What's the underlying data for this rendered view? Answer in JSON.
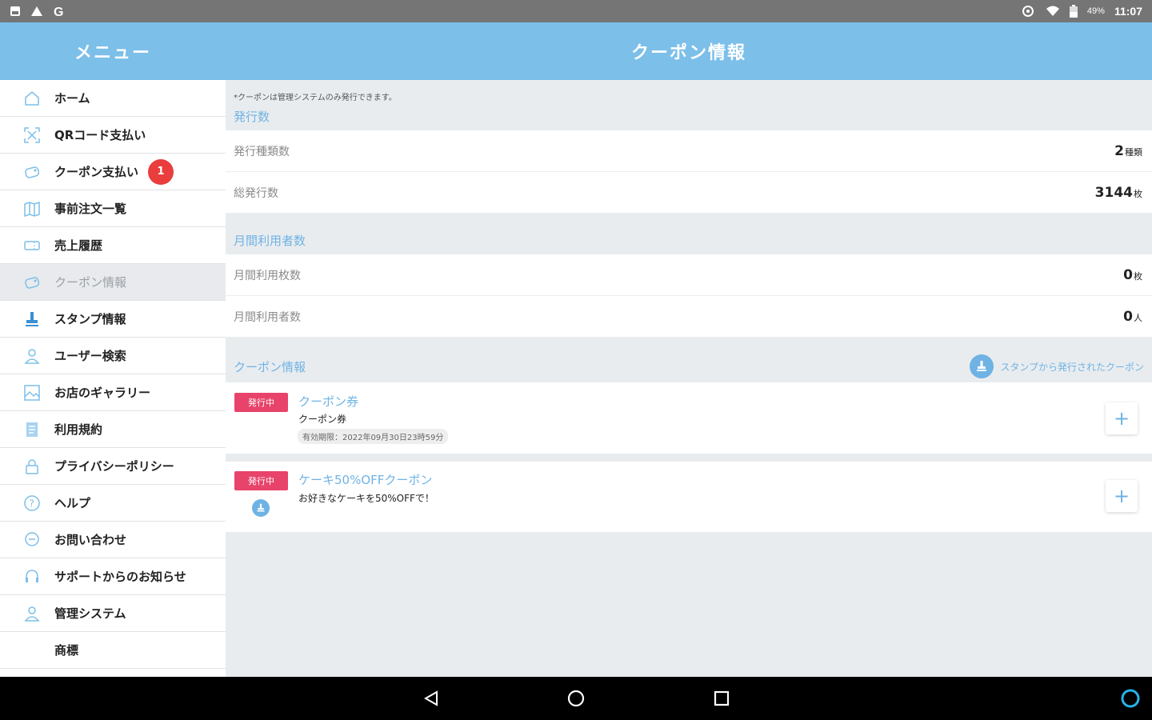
{
  "statusbar": {
    "battery": "49%",
    "time": "11:07"
  },
  "header": {
    "menu_title": "メニュー",
    "page_title": "クーポン情報"
  },
  "sidebar": {
    "items": [
      {
        "label": "ホーム",
        "icon": "home-icon"
      },
      {
        "label": "QRコード支払い",
        "icon": "qr-scan-icon"
      },
      {
        "label": "クーポン支払い",
        "icon": "coupon-icon",
        "badge": "1"
      },
      {
        "label": "事前注文一覧",
        "icon": "map-icon"
      },
      {
        "label": "売上履歴",
        "icon": "ticket-icon"
      },
      {
        "label": "クーポン情報",
        "icon": "coupon-info-icon",
        "active": true
      },
      {
        "label": "スタンプ情報",
        "icon": "stamp-icon"
      },
      {
        "label": "ユーザー検索",
        "icon": "user-search-icon"
      },
      {
        "label": "お店のギャラリー",
        "icon": "gallery-icon"
      },
      {
        "label": "利用規約",
        "icon": "document-icon"
      },
      {
        "label": "プライバシーポリシー",
        "icon": "lock-icon"
      },
      {
        "label": "ヘルプ",
        "icon": "help-icon"
      },
      {
        "label": "お問い合わせ",
        "icon": "chat-icon"
      },
      {
        "label": "サポートからのお知らせ",
        "icon": "headset-icon"
      },
      {
        "label": "管理システム",
        "icon": "admin-icon"
      },
      {
        "label": "商標",
        "icon": ""
      }
    ]
  },
  "main": {
    "note": "*クーポンは管理システムのみ発行できます。",
    "issued": {
      "title": "発行数",
      "rows": [
        {
          "label": "発行種類数",
          "value": "2",
          "unit": "種類"
        },
        {
          "label": "総発行数",
          "value": "3144",
          "unit": "枚"
        }
      ]
    },
    "monthly": {
      "title": "月間利用者数",
      "rows": [
        {
          "label": "月間利用枚数",
          "value": "0",
          "unit": "枚"
        },
        {
          "label": "月間利用者数",
          "value": "0",
          "unit": "人"
        }
      ]
    },
    "coupon_info": {
      "title": "クーポン情報",
      "stamp_link": "スタンプから発行されたクーポン",
      "coupons": [
        {
          "status": "発行中",
          "title": "クーポン券",
          "subtitle": "クーポン券",
          "period": "有効期限：2022年09月30日23時59分"
        },
        {
          "status": "発行中",
          "title": "ケーキ50%OFFクーポン",
          "subtitle": "お好きなケーキを50%OFFで！"
        }
      ]
    }
  },
  "colors": {
    "header": "#7cbfe9",
    "accent": "#6fb3e4",
    "badge": "#ea3d3d",
    "status_tag": "#e8436a"
  }
}
